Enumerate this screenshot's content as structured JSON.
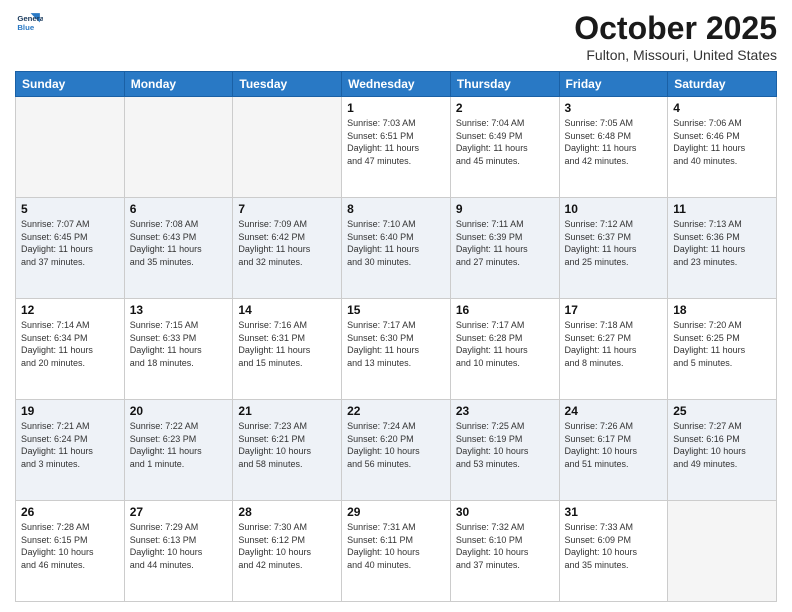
{
  "logo": {
    "line1": "General",
    "line2": "Blue"
  },
  "title": "October 2025",
  "location": "Fulton, Missouri, United States",
  "days_of_week": [
    "Sunday",
    "Monday",
    "Tuesday",
    "Wednesday",
    "Thursday",
    "Friday",
    "Saturday"
  ],
  "weeks": [
    [
      {
        "day": "",
        "info": ""
      },
      {
        "day": "",
        "info": ""
      },
      {
        "day": "",
        "info": ""
      },
      {
        "day": "1",
        "info": "Sunrise: 7:03 AM\nSunset: 6:51 PM\nDaylight: 11 hours\nand 47 minutes."
      },
      {
        "day": "2",
        "info": "Sunrise: 7:04 AM\nSunset: 6:49 PM\nDaylight: 11 hours\nand 45 minutes."
      },
      {
        "day": "3",
        "info": "Sunrise: 7:05 AM\nSunset: 6:48 PM\nDaylight: 11 hours\nand 42 minutes."
      },
      {
        "day": "4",
        "info": "Sunrise: 7:06 AM\nSunset: 6:46 PM\nDaylight: 11 hours\nand 40 minutes."
      }
    ],
    [
      {
        "day": "5",
        "info": "Sunrise: 7:07 AM\nSunset: 6:45 PM\nDaylight: 11 hours\nand 37 minutes."
      },
      {
        "day": "6",
        "info": "Sunrise: 7:08 AM\nSunset: 6:43 PM\nDaylight: 11 hours\nand 35 minutes."
      },
      {
        "day": "7",
        "info": "Sunrise: 7:09 AM\nSunset: 6:42 PM\nDaylight: 11 hours\nand 32 minutes."
      },
      {
        "day": "8",
        "info": "Sunrise: 7:10 AM\nSunset: 6:40 PM\nDaylight: 11 hours\nand 30 minutes."
      },
      {
        "day": "9",
        "info": "Sunrise: 7:11 AM\nSunset: 6:39 PM\nDaylight: 11 hours\nand 27 minutes."
      },
      {
        "day": "10",
        "info": "Sunrise: 7:12 AM\nSunset: 6:37 PM\nDaylight: 11 hours\nand 25 minutes."
      },
      {
        "day": "11",
        "info": "Sunrise: 7:13 AM\nSunset: 6:36 PM\nDaylight: 11 hours\nand 23 minutes."
      }
    ],
    [
      {
        "day": "12",
        "info": "Sunrise: 7:14 AM\nSunset: 6:34 PM\nDaylight: 11 hours\nand 20 minutes."
      },
      {
        "day": "13",
        "info": "Sunrise: 7:15 AM\nSunset: 6:33 PM\nDaylight: 11 hours\nand 18 minutes."
      },
      {
        "day": "14",
        "info": "Sunrise: 7:16 AM\nSunset: 6:31 PM\nDaylight: 11 hours\nand 15 minutes."
      },
      {
        "day": "15",
        "info": "Sunrise: 7:17 AM\nSunset: 6:30 PM\nDaylight: 11 hours\nand 13 minutes."
      },
      {
        "day": "16",
        "info": "Sunrise: 7:17 AM\nSunset: 6:28 PM\nDaylight: 11 hours\nand 10 minutes."
      },
      {
        "day": "17",
        "info": "Sunrise: 7:18 AM\nSunset: 6:27 PM\nDaylight: 11 hours\nand 8 minutes."
      },
      {
        "day": "18",
        "info": "Sunrise: 7:20 AM\nSunset: 6:25 PM\nDaylight: 11 hours\nand 5 minutes."
      }
    ],
    [
      {
        "day": "19",
        "info": "Sunrise: 7:21 AM\nSunset: 6:24 PM\nDaylight: 11 hours\nand 3 minutes."
      },
      {
        "day": "20",
        "info": "Sunrise: 7:22 AM\nSunset: 6:23 PM\nDaylight: 11 hours\nand 1 minute."
      },
      {
        "day": "21",
        "info": "Sunrise: 7:23 AM\nSunset: 6:21 PM\nDaylight: 10 hours\nand 58 minutes."
      },
      {
        "day": "22",
        "info": "Sunrise: 7:24 AM\nSunset: 6:20 PM\nDaylight: 10 hours\nand 56 minutes."
      },
      {
        "day": "23",
        "info": "Sunrise: 7:25 AM\nSunset: 6:19 PM\nDaylight: 10 hours\nand 53 minutes."
      },
      {
        "day": "24",
        "info": "Sunrise: 7:26 AM\nSunset: 6:17 PM\nDaylight: 10 hours\nand 51 minutes."
      },
      {
        "day": "25",
        "info": "Sunrise: 7:27 AM\nSunset: 6:16 PM\nDaylight: 10 hours\nand 49 minutes."
      }
    ],
    [
      {
        "day": "26",
        "info": "Sunrise: 7:28 AM\nSunset: 6:15 PM\nDaylight: 10 hours\nand 46 minutes."
      },
      {
        "day": "27",
        "info": "Sunrise: 7:29 AM\nSunset: 6:13 PM\nDaylight: 10 hours\nand 44 minutes."
      },
      {
        "day": "28",
        "info": "Sunrise: 7:30 AM\nSunset: 6:12 PM\nDaylight: 10 hours\nand 42 minutes."
      },
      {
        "day": "29",
        "info": "Sunrise: 7:31 AM\nSunset: 6:11 PM\nDaylight: 10 hours\nand 40 minutes."
      },
      {
        "day": "30",
        "info": "Sunrise: 7:32 AM\nSunset: 6:10 PM\nDaylight: 10 hours\nand 37 minutes."
      },
      {
        "day": "31",
        "info": "Sunrise: 7:33 AM\nSunset: 6:09 PM\nDaylight: 10 hours\nand 35 minutes."
      },
      {
        "day": "",
        "info": ""
      }
    ]
  ]
}
